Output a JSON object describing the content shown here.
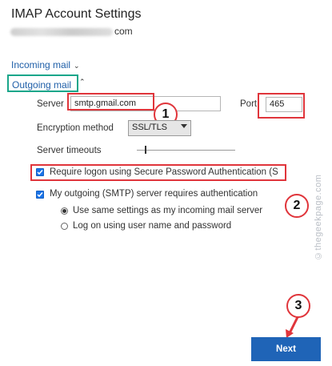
{
  "title": "IMAP Account Settings",
  "email_domain": "com",
  "incoming_mail_label": "Incoming mail",
  "outgoing_mail_label": "Outgoing mail",
  "server_label": "Server",
  "server_value": "smtp.gmail.com",
  "port_label": "Port",
  "port_value": "465",
  "encryption_label": "Encryption method",
  "encryption_value": "SSL/TLS",
  "timeouts_label": "Server timeouts",
  "spa_label": "Require logon using Secure Password Authentication (SPA)",
  "smtp_auth_label": "My outgoing (SMTP) server requires authentication",
  "same_settings_label": "Use same settings as my incoming mail server",
  "logon_label": "Log on using user name and password",
  "next_label": "Next",
  "watermark": "©thegeekpage.com",
  "badges": [
    "1",
    "2",
    "3"
  ],
  "colors": {
    "annotation_red": "#e0353b",
    "highlight_green": "#1aa68a",
    "accent_blue": "#1f64b7",
    "link_blue": "#1f5fa8"
  }
}
